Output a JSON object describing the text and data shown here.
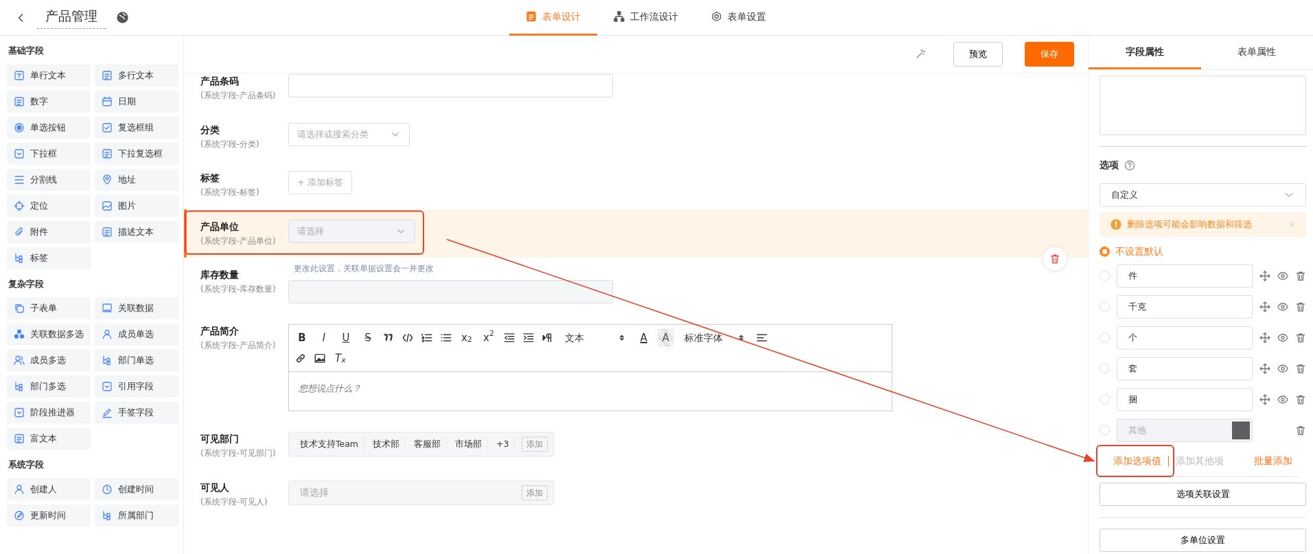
{
  "header": {
    "title": "产品管理"
  },
  "top_tabs": [
    {
      "label": "表单设计",
      "selected": true
    },
    {
      "label": "工作流设计",
      "selected": false
    },
    {
      "label": "表单设置",
      "selected": false
    }
  ],
  "palette": [
    {
      "title": "基础字段",
      "items": [
        "单行文本",
        "多行文本",
        "数字",
        "日期",
        "单选按钮",
        "复选框组",
        "下拉框",
        "下拉复选框",
        "分割线",
        "地址",
        "定位",
        "图片",
        "附件",
        "描述文本",
        "标签"
      ]
    },
    {
      "title": "复杂字段",
      "items": [
        "子表单",
        "关联数据",
        "关联数据多选",
        "成员单选",
        "成员多选",
        "部门单选",
        "部门多选",
        "引用字段",
        "阶段推进器",
        "手签字段",
        "富文本"
      ]
    },
    {
      "title": "系统字段",
      "items": [
        "创建人",
        "创建时间",
        "更新时间",
        "所属部门"
      ]
    }
  ],
  "toolbar": {
    "buttons": [
      {
        "label": "预览",
        "primary": false
      },
      {
        "label": "保存",
        "primary": true
      }
    ]
  },
  "form_fields": [
    {
      "kind": "input",
      "label": "产品条码",
      "sub": "(系统字段-产品条码)",
      "selected": false
    },
    {
      "kind": "select",
      "label": "分类",
      "sub": "(系统字段-分类)",
      "placeholder": "请选择或搜索分类",
      "selected": false
    },
    {
      "kind": "tag_button",
      "label": "标签",
      "sub": "(系统字段-标签)",
      "button": "+ 添加标签",
      "selected": false
    },
    {
      "kind": "select_wide",
      "label": "产品单位",
      "sub": "(系统字段-产品单位)",
      "placeholder": "请选择",
      "selected": true
    },
    {
      "kind": "input",
      "label": "库存数量",
      "sub": "(系统字段-库存数量)",
      "note": "更改此设置，关联单据设置会一并更改",
      "selected": false
    },
    {
      "kind": "rich",
      "label": "产品简介",
      "sub": "(系统字段-产品简介)",
      "placeholder": "您想说点什么？",
      "selected": false,
      "toolbar": [
        {
          "kind": "glyph",
          "label": "B"
        },
        {
          "kind": "glyph",
          "label": "I"
        },
        {
          "kind": "glyph",
          "label": "U"
        },
        {
          "kind": "glyph",
          "label": "S"
        },
        {
          "kind": "icon"
        },
        {
          "kind": "icon"
        },
        {
          "kind": "icon"
        },
        {
          "kind": "icon"
        },
        {
          "kind": "glyph",
          "label": "x$_{2}$"
        },
        {
          "kind": "glyph",
          "label": "x$^{2}$"
        },
        {
          "kind": "icon"
        },
        {
          "kind": "icon"
        },
        {
          "kind": "icon"
        },
        {
          "kind": "select",
          "label": "文本"
        },
        {
          "kind": "glyph",
          "label": "A"
        },
        {
          "kind": "glyph",
          "label": "A"
        },
        {
          "kind": "select",
          "label": "标准字体"
        },
        {
          "kind": "icon"
        },
        {
          "kind": "icon"
        },
        {
          "kind": "icon"
        },
        {
          "kind": "glyph",
          "label": "T$_{x}$"
        }
      ]
    },
    {
      "kind": "tags",
      "label": "可见部门",
      "sub": "(系统字段-可见部门)",
      "tags": [
        "技术支持Team",
        "技术部",
        "客服部",
        "市场部",
        "+3"
      ],
      "button": "添加",
      "selected": false
    },
    {
      "kind": "people",
      "label": "可见人",
      "sub": "(系统字段-可见人)",
      "placeholder": "请选择",
      "button": "添加",
      "selected": false
    }
  ],
  "panel": {
    "tabs": [
      {
        "label": "字段属性",
        "selected": true
      },
      {
        "label": "表单属性",
        "selected": false
      }
    ],
    "options_title": "选项",
    "source": "自定义",
    "alert": "删除选项可能会影响数据和筛选",
    "default_option": {
      "label": "不设置默认",
      "selected": true
    },
    "options": [
      {
        "value": "件",
        "selected": false
      },
      {
        "value": "千克",
        "selected": false
      },
      {
        "value": "个",
        "selected": false
      },
      {
        "value": "套",
        "selected": false
      },
      {
        "value": "捆",
        "selected": false
      }
    ],
    "other_option": {
      "placeholder": "其他",
      "selected": false
    },
    "links": [
      {
        "label": "添加选项值",
        "disabled": false
      },
      {
        "label": "添加其他项",
        "disabled": true
      },
      {
        "label": "批量添加",
        "disabled": false
      }
    ],
    "buttons": [
      "选项关联设置",
      "多单位设置"
    ]
  }
}
